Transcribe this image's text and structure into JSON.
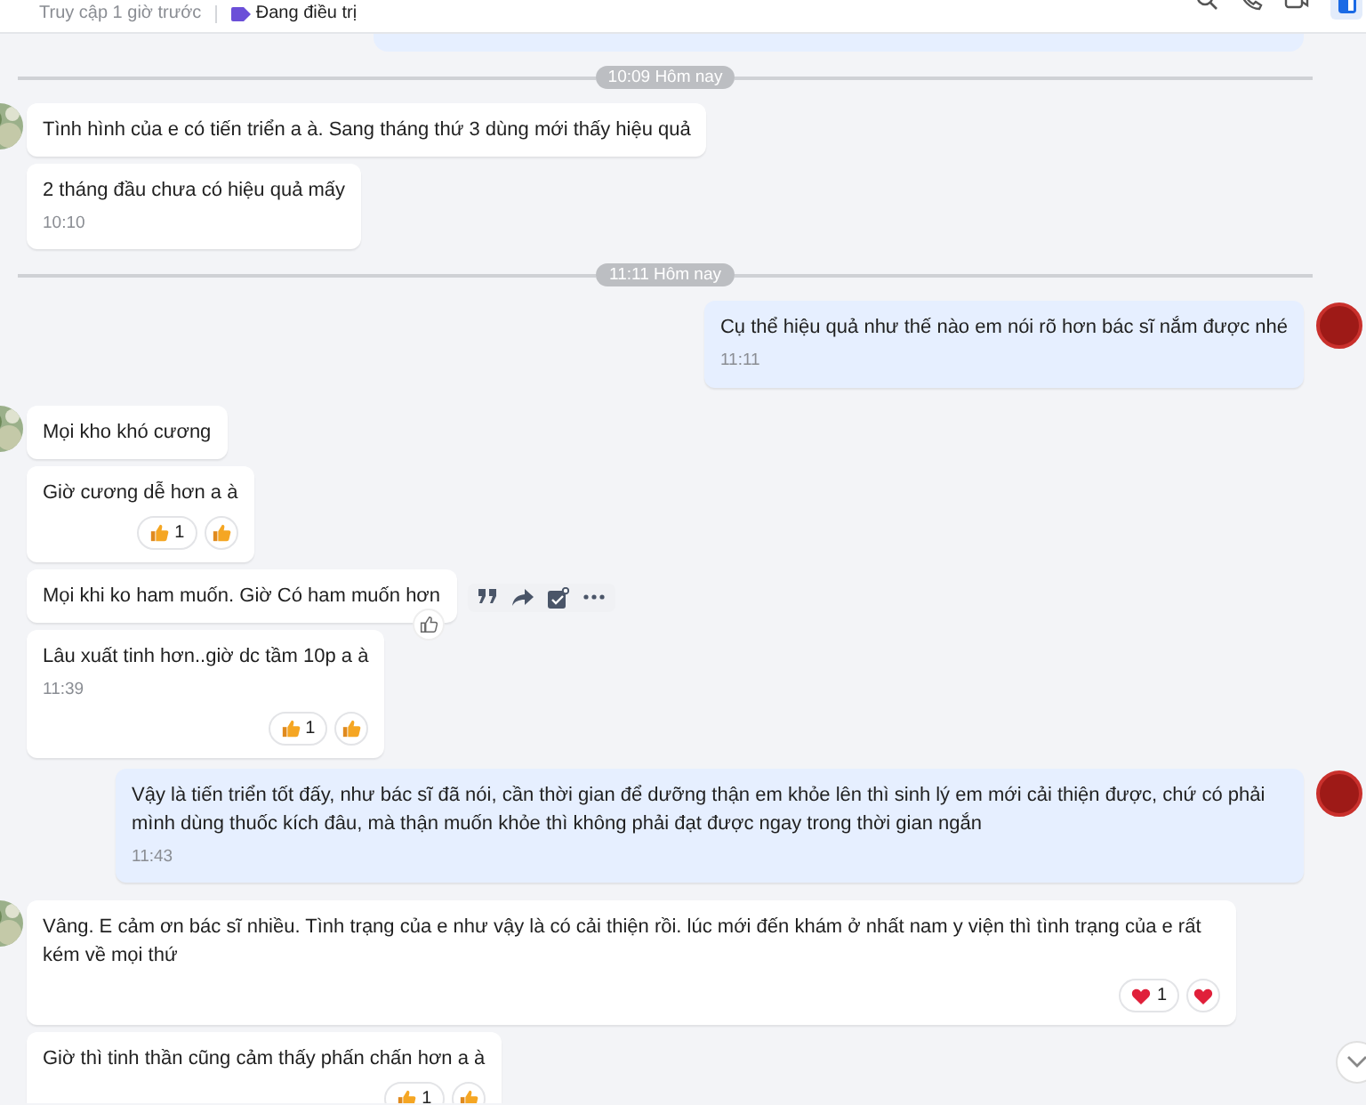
{
  "header": {
    "last_seen": "Truy cập 1 giờ trước",
    "tag": "Đang điều trị"
  },
  "items": [
    {
      "kind": "cutoff"
    },
    {
      "kind": "divider",
      "label": "10:09 Hôm nay"
    },
    {
      "kind": "in",
      "avatar": true,
      "text": "Tình hình của e có tiến triển a à. Sang tháng thứ 3 dùng mới thấy hiệu quả"
    },
    {
      "kind": "in",
      "avatar": false,
      "text": "2 tháng đầu chưa có hiệu quả mấy",
      "time": "10:10"
    },
    {
      "kind": "divider",
      "label": "11:11 Hôm nay"
    },
    {
      "kind": "out",
      "avatar": true,
      "text": "Cụ thể hiệu quả như thế nào em nói rõ hơn bác sĩ nắm được nhé",
      "time": "11:11"
    },
    {
      "kind": "in",
      "avatar": true,
      "text": "Mọi kho khó cương"
    },
    {
      "kind": "in",
      "avatar": false,
      "text": "Giờ cương dễ hơn a à",
      "reactions": [
        {
          "kind": "like",
          "count": "1"
        },
        {
          "kind": "like"
        }
      ]
    },
    {
      "kind": "in",
      "avatar": false,
      "text": "Mọi khi ko ham muốn. Giờ Có ham muốn hơn",
      "hovered": true
    },
    {
      "kind": "in",
      "avatar": false,
      "text": "Lâu xuất tinh hơn..giờ  dc tầm 10p a à",
      "time": "11:39",
      "reactions": [
        {
          "kind": "like",
          "count": "1"
        },
        {
          "kind": "like"
        }
      ]
    },
    {
      "kind": "out",
      "avatar": true,
      "text": "Vậy là tiến triển tốt đấy, như bác sĩ đã nói, cần thời gian để dưỡng thận em khỏe lên thì sinh lý em mới cải thiện được, chứ có phải mình dùng thuốc kích đâu, mà thận muốn khỏe thì không phải đạt được ngay trong thời gian ngắn",
      "time": "11:43"
    },
    {
      "kind": "in",
      "avatar": true,
      "text": "Vâng. E cảm ơn bác sĩ nhiều. Tình trạng của e như vậy là có cải thiện  rồi.  lúc mới đến khám ở nhất nam y viện thì tình trạng của e rất kém về mọi thứ",
      "reactions": [
        {
          "kind": "heart",
          "count": "1"
        },
        {
          "kind": "heart"
        }
      ]
    },
    {
      "kind": "in",
      "avatar": false,
      "text": "Giờ thì tinh thần cũng cảm thấy phấn chấn hơn a à",
      "reactions": [
        {
          "kind": "like",
          "count": "1"
        },
        {
          "kind": "like"
        }
      ]
    }
  ]
}
